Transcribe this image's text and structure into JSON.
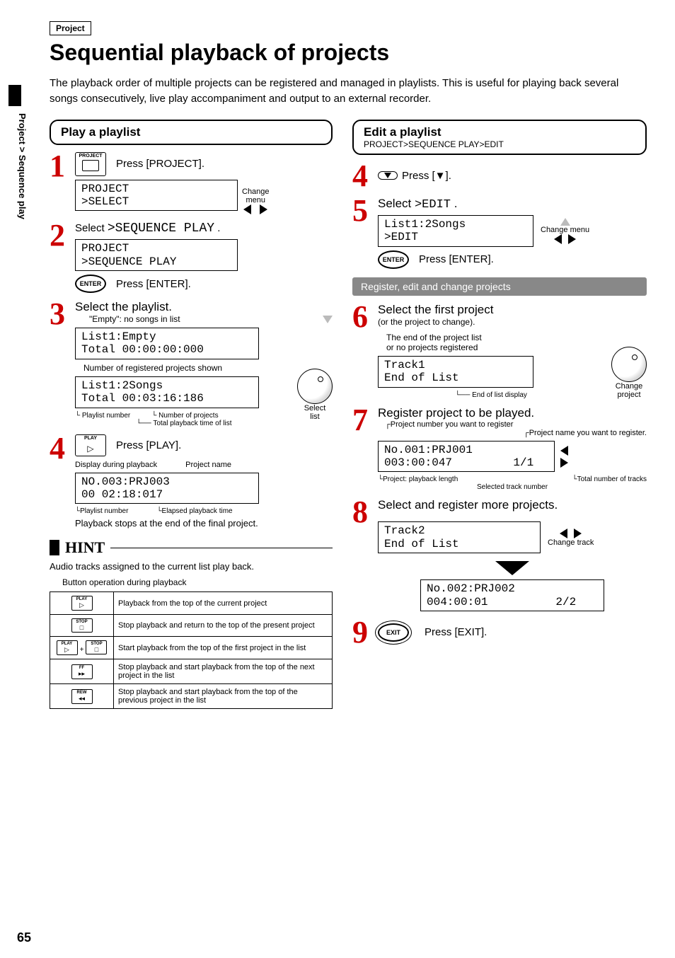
{
  "side_tab": "Project > Sequence play",
  "page_number": "65",
  "project_tag": "Project",
  "title": "Sequential playback of projects",
  "intro": "The playback order of multiple projects can be registered and managed in playlists. This is useful for playing back several songs consecutively, live play accompaniment and output to an external recorder.",
  "left": {
    "header": "Play a playlist",
    "step1": {
      "btn_label": "PROJECT",
      "text": "Press [PROJECT].",
      "lcd": "PROJECT\n>SELECT",
      "change_menu": "Change\nmenu"
    },
    "step2": {
      "text_prefix": "Select ",
      "lcd_inline": ">SEQUENCE PLAY",
      "text_suffix": " .",
      "lcd": "PROJECT\n>SEQUENCE PLAY",
      "enter_btn": "ENTER",
      "enter_text": "Press [ENTER]."
    },
    "step3": {
      "heading": "Select the playlist.",
      "empty_note": "\"Empty\": no songs in list",
      "lcd1": "List1:Empty\nTotal 00:00:00:000",
      "reg_note": "Number of registered projects shown",
      "lcd2": "List1:2Songs\nTotal 00:03:16:186",
      "select_list": "Select\nlist",
      "annot_playlist": "Playlist number",
      "annot_numproj": "Number of projects",
      "annot_total": "Total playback time of list"
    },
    "step4": {
      "btn_label": "PLAY",
      "text": "Press [PLAY].",
      "disp_label": "Display during playback",
      "proj_name": "Project name",
      "lcd": "NO.003:PRJ003\n00 02:18:017",
      "annot_playlist": "Playlist number",
      "annot_elapsed": "Elapsed playback time",
      "stop_note": "Playback stops at the end of the final project."
    }
  },
  "hint": {
    "label": "HINT",
    "line1": "Audio tracks assigned to the current list play back.",
    "table_caption": "Button operation during playback",
    "rows": [
      {
        "icon": "PLAY ▷",
        "desc": "Playback from the top of the current project"
      },
      {
        "icon": "STOP □",
        "desc": "Stop playback and return to the top of the present project"
      },
      {
        "icon": "PLAY ▷ + STOP □",
        "desc": "Start playback from the top of the first project in the list"
      },
      {
        "icon": "FF ▸▸",
        "desc": "Stop playback and start playback from the top of the next project in the list"
      },
      {
        "icon": "REW ◂◂",
        "desc": "Stop playback and start playback from the top of the previous project in the list"
      }
    ]
  },
  "right": {
    "header": "Edit a playlist",
    "breadcrumb": "PROJECT>SEQUENCE PLAY>EDIT",
    "step4": {
      "text": "Press [▼]."
    },
    "step5": {
      "text_prefix": "Select ",
      "lcd_inline": ">EDIT",
      "text_suffix": " .",
      "lcd": "List1:2Songs\n>EDIT",
      "change_menu": "Change menu",
      "enter_btn": "ENTER",
      "enter_text": "Press [ENTER]."
    },
    "dark_bar": "Register, edit and change projects",
    "step6": {
      "heading": "Select the first project",
      "sub": "(or the project to change).",
      "note": "The end of the project list\nor no projects registered",
      "lcd": "Track1\nEnd of List",
      "change_proj": "Change\nproject",
      "end_annot": "End of list display"
    },
    "step7": {
      "heading": "Register project to be played.",
      "annot_projnum": "Project number you want to register",
      "annot_projname": "Project name you want to register.",
      "lcd": "No.001:PRJ001\n003:00:047         1/1",
      "annot_len": "Project: playback length",
      "annot_sel": "Selected track number",
      "annot_total": "Total number of tracks"
    },
    "step8": {
      "heading": "Select and register more projects.",
      "lcd1": "Track2\nEnd of List",
      "change_track": "Change track",
      "lcd2": "No.002:PRJ002\n004:00:01          2/2"
    },
    "step9": {
      "btn": "EXIT",
      "text": "Press [EXIT]."
    }
  }
}
